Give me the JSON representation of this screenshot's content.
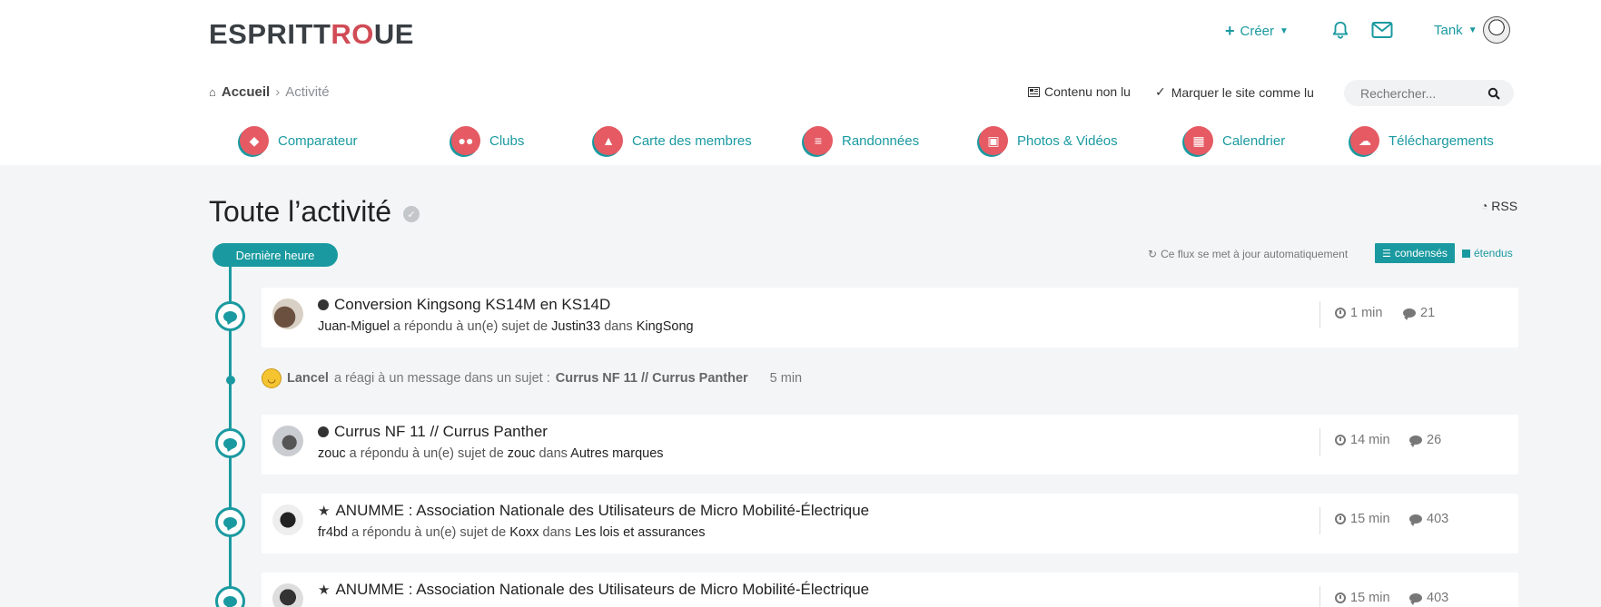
{
  "header": {
    "logo_part1": "ESPRIT",
    "logo_part2": "RO",
    "logo_part3": "UE",
    "logo_prefix_t": "T",
    "create_label": "Créer",
    "user_name": "Tank"
  },
  "breadcrumb": {
    "home": "Accueil",
    "current": "Activité"
  },
  "toolbar": {
    "unread": "Contenu non lu",
    "mark_read": "Marquer le site comme lu",
    "search_placeholder": "Rechercher..."
  },
  "nav": [
    {
      "label": "Comparateur",
      "icon": "tag-icon"
    },
    {
      "label": "Clubs",
      "icon": "users-icon"
    },
    {
      "label": "Carte des membres",
      "icon": "map-pin-icon"
    },
    {
      "label": "Randonnées",
      "icon": "signpost-icon"
    },
    {
      "label": "Photos & Vidéos",
      "icon": "image-icon"
    },
    {
      "label": "Calendrier",
      "icon": "calendar-icon"
    },
    {
      "label": "Téléchargements",
      "icon": "cloud-icon"
    }
  ],
  "main": {
    "title": "Toute l’activité",
    "rss": "RSS",
    "pill": "Dernière heure",
    "auto_update": "Ce flux se met à jour automatiquement",
    "view_condensed": "condensés",
    "view_expanded": "étendus"
  },
  "items": [
    {
      "title": "Conversion Kingsong KS14M en KS14D",
      "marker": "bullet",
      "user": "Juan-Miguel",
      "action": "a répondu à un(e) sujet de",
      "author": "Justin33",
      "in": "dans",
      "forum": "KingSong",
      "time": "1 min",
      "replies": "21"
    },
    {
      "title": "Currus NF 11 // Currus Panther",
      "marker": "bullet",
      "user": "zouc",
      "action": "a répondu à un(e) sujet de",
      "author": "zouc",
      "in": "dans",
      "forum": "Autres marques",
      "time": "14 min",
      "replies": "26"
    },
    {
      "title": "ANUMME : Association Nationale des Utilisateurs de Micro Mobilité-Électrique",
      "marker": "star",
      "user": "fr4bd",
      "action": "a répondu à un(e) sujet de",
      "author": "Koxx",
      "in": "dans",
      "forum": "Les lois et assurances",
      "time": "15 min",
      "replies": "403"
    },
    {
      "title": "ANUMME : Association Nationale des Utilisateurs de Micro Mobilité-Électrique",
      "marker": "star",
      "time": "15 min",
      "replies": "403"
    }
  ],
  "reaction": {
    "user": "Lancel",
    "text": "a réagi à un message dans un sujet :",
    "topic": "Currus NF 11 // Currus Panther",
    "time": "5 min"
  }
}
